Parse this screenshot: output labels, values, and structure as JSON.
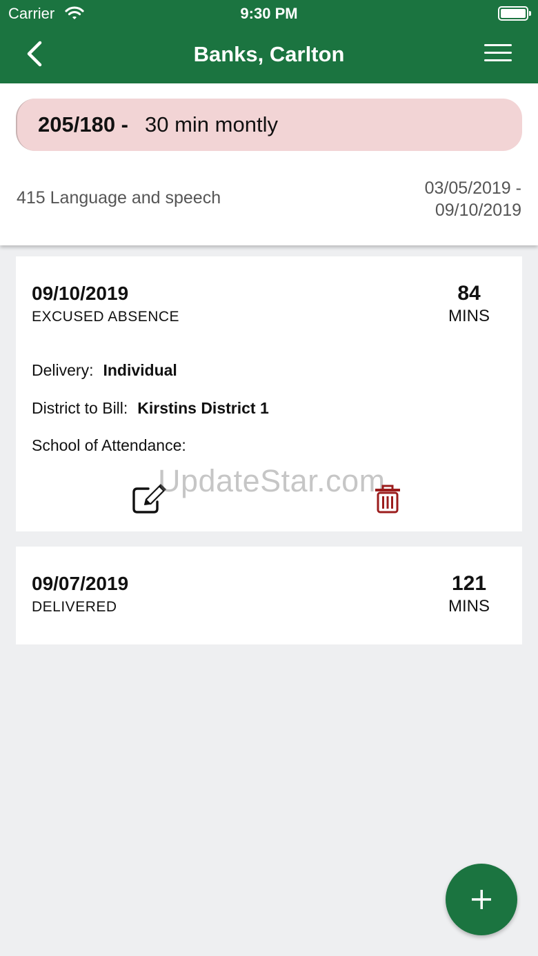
{
  "status_bar": {
    "carrier": "Carrier",
    "time": "9:30 PM",
    "icons": [
      "wifi-icon",
      "battery-icon"
    ]
  },
  "navbar": {
    "title": "Banks, Carlton",
    "back_icon": "chevron-left-icon",
    "menu_icon": "hamburger-menu-icon"
  },
  "goal": {
    "code": "205/180 -",
    "description": "30 min montly"
  },
  "service": {
    "name": "415 Language and speech",
    "date_start": "03/05/2019 -",
    "date_end": "09/10/2019"
  },
  "sessions": [
    {
      "date": "09/10/2019",
      "status": "EXCUSED ABSENCE",
      "minutes": "84",
      "minutes_unit": "MINS",
      "delivery_label": "Delivery:",
      "delivery_value": "Individual",
      "district_label": "District to Bill:",
      "district_value": "Kirstins District 1",
      "school_label": "School of Attendance:",
      "school_value": "",
      "actions": [
        "edit-icon",
        "trash-icon"
      ]
    },
    {
      "date": "09/07/2019",
      "status": "DELIVERED",
      "minutes": "121",
      "minutes_unit": "MINS"
    }
  ],
  "watermark": "UpdateStar.com",
  "fab": {
    "icon": "plus-icon"
  },
  "colors": {
    "primary_green": "#1b7440",
    "goal_pill_bg": "#f2d4d5",
    "delete_red": "#9b1c1c",
    "background": "#eeeff1"
  }
}
